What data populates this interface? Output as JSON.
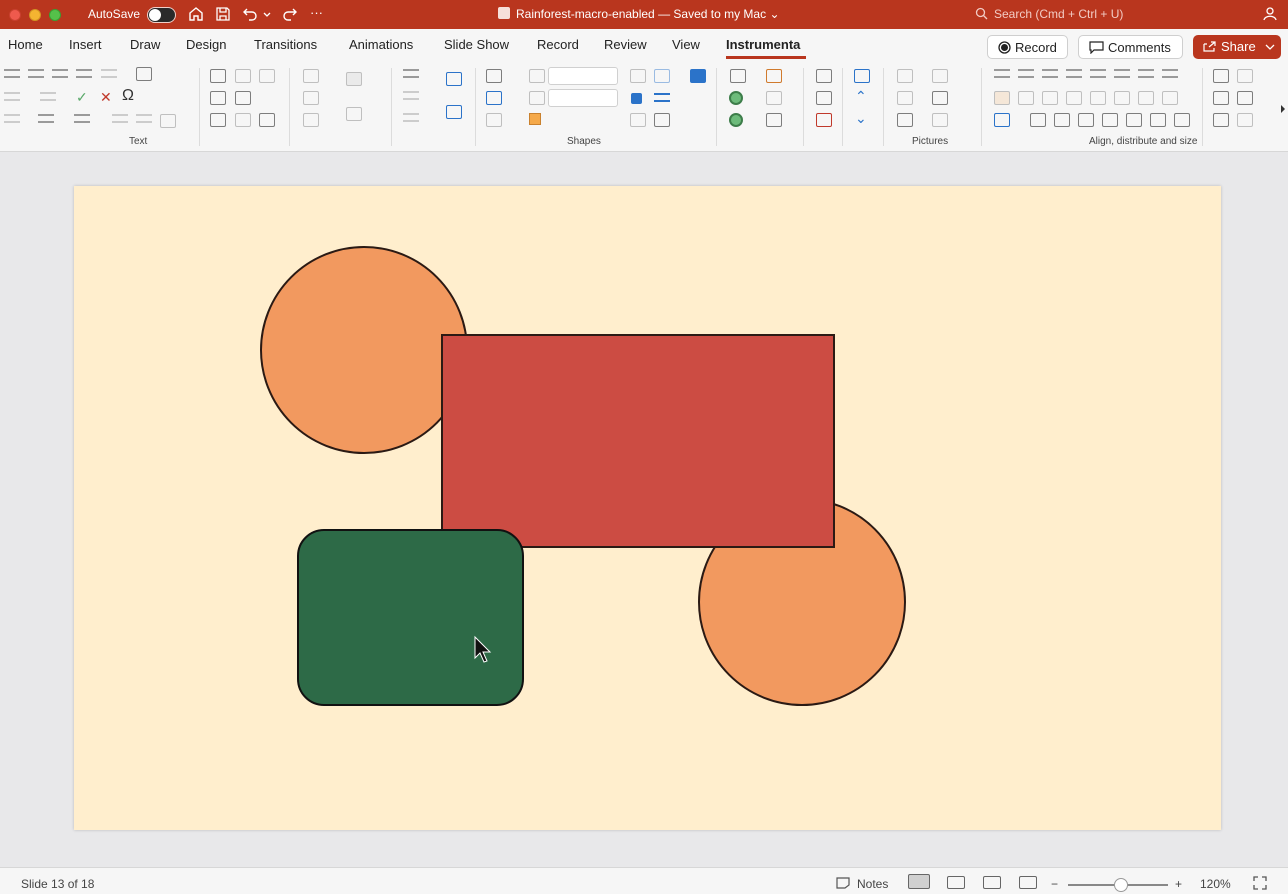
{
  "titlebar": {
    "autosave_label": "AutoSave",
    "doc_title": "Rainforest-macro-enabled — Saved to my Mac",
    "title_chevron": "⌄",
    "search_placeholder": "Search (Cmd + Ctrl + U)",
    "more": "···"
  },
  "tabs": [
    "Home",
    "Insert",
    "Draw",
    "Design",
    "Transitions",
    "Animations",
    "Slide Show",
    "Record",
    "Review",
    "View",
    "Instrumenta"
  ],
  "active_tab": "Instrumenta",
  "actions": {
    "record_label": "Record",
    "comments_label": "Comments",
    "share_label": "Share"
  },
  "ribbon_groups": {
    "text": "Text",
    "shapes": "Shapes",
    "pictures": "Pictures",
    "align": "Align, distribute and size"
  },
  "slide": {
    "background": "#ffeecd",
    "shapes": [
      {
        "kind": "circle",
        "name": "orange-circle-top",
        "fill": "#f2995f"
      },
      {
        "kind": "rect",
        "name": "red-rectangle",
        "fill": "#cc4c43"
      },
      {
        "kind": "circle",
        "name": "orange-circle-bottom",
        "fill": "#f2995f"
      },
      {
        "kind": "rounded-rect",
        "name": "green-rounded-rectangle",
        "fill": "#2d6a47"
      }
    ]
  },
  "status": {
    "slide_counter": "Slide 13 of 18",
    "notes_label": "Notes",
    "zoom_minus": "−",
    "zoom_plus": "+",
    "zoom_level": "120%"
  },
  "colors": {
    "accent": "#b9361e",
    "shape_stroke": "#2b1a14"
  }
}
